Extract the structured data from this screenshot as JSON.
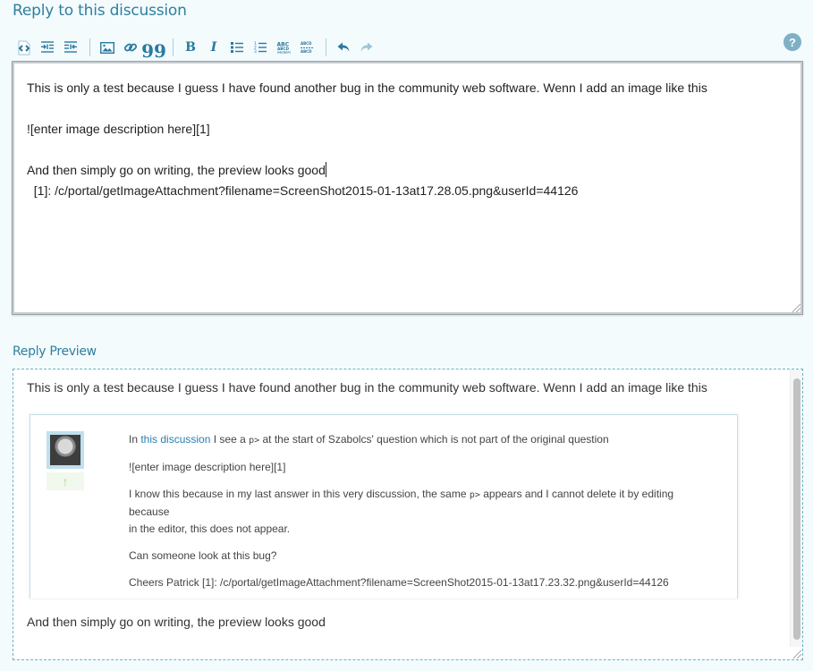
{
  "reply": {
    "heading": "Reply to this discussion",
    "help_label": "?",
    "toolbar": {
      "groups": [
        [
          "insert-code-snippet",
          "indent",
          "outdent"
        ],
        [
          "insert-image",
          "insert-link",
          "blockquote"
        ],
        [
          "bold",
          "italic",
          "bulleted-list",
          "numbered-list",
          "heading",
          "horizontal-rule"
        ],
        [
          "undo",
          "redo"
        ]
      ],
      "bold_label": "B",
      "italic_label": "I",
      "quote_label": "99"
    },
    "editor": {
      "lines": [
        "This is only a test because I guess I have found another bug in the community web software. Wenn I add an image like this",
        "",
        "![enter image description here][1]",
        "",
        "And then simply go on writing, the preview looks good",
        "  [1]: /c/portal/getImageAttachment?filename=ScreenShot2015-01-13at17.28.05.png&userId=44126"
      ]
    }
  },
  "preview": {
    "label": "Reply Preview",
    "first_line": "This is only a test because I guess I have found another bug in the community web software. Wenn I add an image like this",
    "embedded_post": {
      "vote_icon": "↑",
      "line1_prefix": "In ",
      "line1_link": "this discussion",
      "line1_middle": " I see a ",
      "line1_code": "p>",
      "line1_suffix": " at the start of Szabolcs' question which is not part of the original question",
      "line2": "![enter image description here][1]",
      "line3_prefix": "I know this because in my last answer in this very discussion, the same ",
      "line3_code": "p>",
      "line3_suffix": " appears and I cannot delete it by editing because",
      "line3_cont": "in the editor, this does not appear.",
      "line4": "Can someone look at this bug?",
      "line5": "Cheers Patrick [1]: /c/portal/getImageAttachment?filename=ScreenShot2015-01-13at17.23.32.png&userId=44126"
    },
    "last_line": "And then simply go on writing, the preview looks good"
  }
}
